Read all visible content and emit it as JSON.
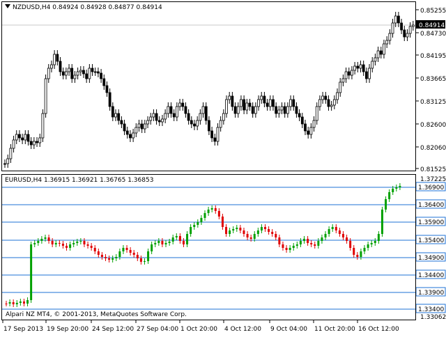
{
  "top_chart": {
    "title": "NZDUSD,H4  0.84924 0.84928 0.84877 0.84914",
    "price_labels": [
      "0.85255",
      "0.84730",
      "0.84195",
      "0.83665",
      "0.83125",
      "0.82600",
      "0.82060",
      "0.81525"
    ],
    "current_price": "0.84914",
    "bullish_color": "#000000",
    "bearish_color": "#000000"
  },
  "bottom_chart": {
    "title": "EURUSD,H4  1.36915 1.36921 1.36765 1.36853",
    "top_label": "1.37225",
    "level_labels": [
      "1.36900",
      "1.36400",
      "1.35900",
      "1.35400",
      "1.34900",
      "1.34400",
      "1.33900",
      "1.33400"
    ],
    "bottom_label": "1.33062",
    "level_color": "#1e72d6",
    "bullish_color": "#00a000",
    "bearish_color": "#e00000",
    "copyright": "Alpari NZ MT4, © 2001-2013, MetaQuotes Software Corp."
  },
  "time_axis": {
    "labels": [
      "17 Sep 2013",
      "19 Sep 20:00",
      "24 Sep 12:00",
      "27 Sep 04:00",
      "1 Oct 20:00",
      "4 Oct 12:00",
      "9 Oct 04:00",
      "11 Oct 20:00",
      "16 Oct 12:00"
    ]
  }
}
